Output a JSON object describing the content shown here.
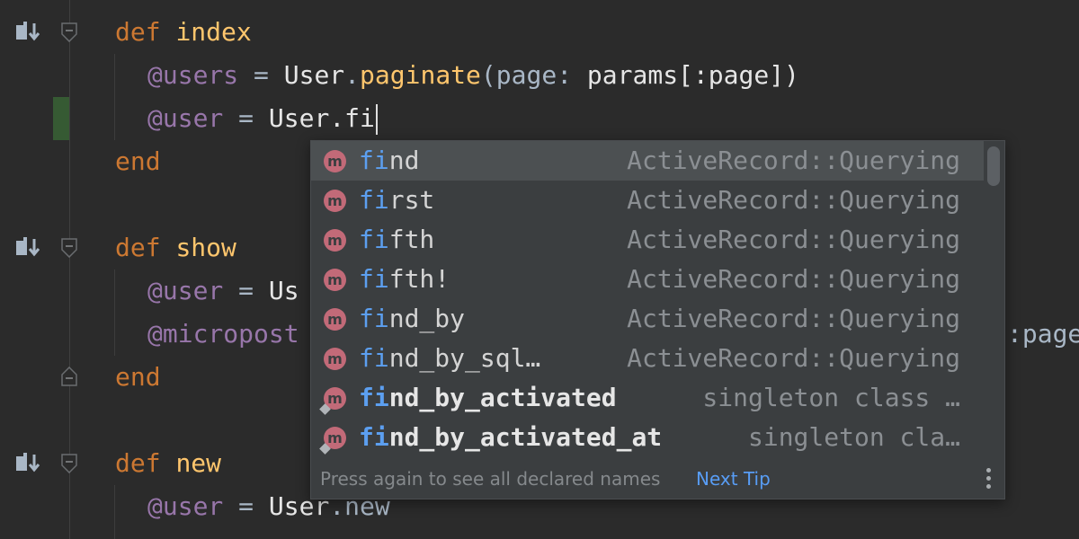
{
  "editor": {
    "lines": [
      {
        "kw": "def",
        "name": "index"
      },
      {
        "ivar": "@users",
        "eq": " = ",
        "cls": "User",
        "dot": ".",
        "call": "paginate",
        "rest_open": "(",
        "param": "page",
        "colon": ": ",
        "args": "params[:page])"
      },
      {
        "ivar": "@user",
        "eq": " = ",
        "cls": "User",
        "typed": ".fi"
      },
      {
        "kw": "end"
      },
      {
        "kw": "def",
        "name": "show"
      },
      {
        "ivar": "@user",
        "eq": " = ",
        "partial": "Us"
      },
      {
        "ivar": "@micropost",
        "tail": ":page"
      },
      {
        "kw": "end"
      },
      {
        "kw": "def",
        "name": "new"
      },
      {
        "ivar": "@user",
        "eq": " = ",
        "cls": "User",
        "dot": ".",
        "method": "new"
      }
    ]
  },
  "completion": {
    "items": [
      {
        "kind": "m",
        "match": "fi",
        "rest": "nd",
        "location": "ActiveRecord::Querying"
      },
      {
        "kind": "m",
        "match": "fi",
        "rest": "rst",
        "location": "ActiveRecord::Querying"
      },
      {
        "kind": "m",
        "match": "fi",
        "rest": "fth",
        "location": "ActiveRecord::Querying"
      },
      {
        "kind": "m",
        "match": "fi",
        "rest": "fth!",
        "location": "ActiveRecord::Querying"
      },
      {
        "kind": "m",
        "match": "fi",
        "rest": "nd_by",
        "location": "ActiveRecord::Querying"
      },
      {
        "kind": "m",
        "match": "fi",
        "rest": "nd_by_sql…",
        "location": "ActiveRecord::Querying"
      },
      {
        "kind": "m",
        "match": "fi",
        "rest": "nd_by_activated",
        "location": "singleton class …"
      },
      {
        "kind": "m",
        "match": "fi",
        "rest": "nd_by_activated_at",
        "location": "singleton cla…"
      }
    ],
    "footer_hint": "Press again to see all declared names",
    "footer_link": "Next Tip"
  }
}
